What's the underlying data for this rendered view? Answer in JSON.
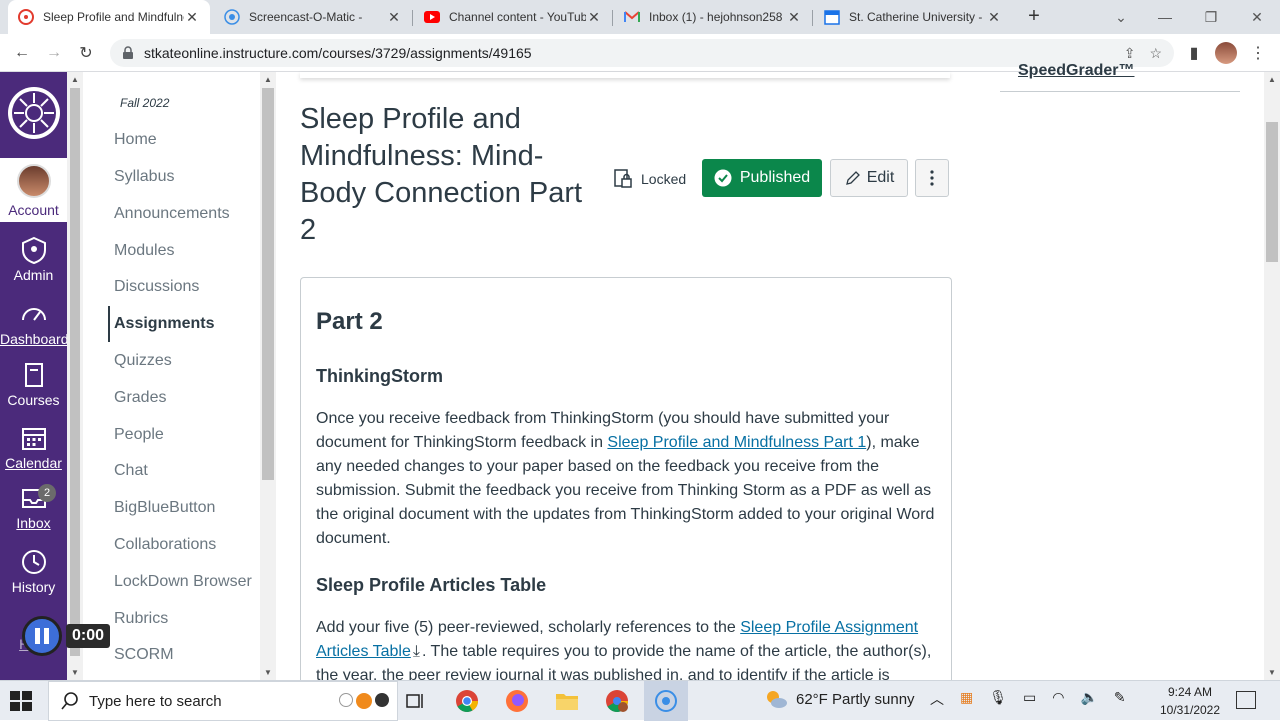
{
  "browser": {
    "tabs": [
      {
        "title": "Sleep Profile and Mindfulness",
        "active": true
      },
      {
        "title": "Screencast-O-Matic -"
      },
      {
        "title": "Channel content - YouTube"
      },
      {
        "title": "Inbox (1) - hejohnson258"
      },
      {
        "title": "St. Catherine University -"
      }
    ],
    "url": "stkateonline.instructure.com/courses/3729/assignments/49165"
  },
  "global_nav": {
    "account": "Account",
    "admin": "Admin",
    "dashboard": "Dashboard",
    "courses": "Courses",
    "calendar": "Calendar",
    "inbox": "Inbox",
    "inbox_badge": "2",
    "history": "History",
    "help": "Help"
  },
  "course_nav": {
    "term": "Fall 2022",
    "items": [
      "Home",
      "Syllabus",
      "Announcements",
      "Modules",
      "Discussions",
      "Assignments",
      "Quizzes",
      "Grades",
      "People",
      "Chat",
      "BigBlueButton",
      "Collaborations",
      "LockDown Browser",
      "Rubrics",
      "SCORM"
    ]
  },
  "assignment": {
    "title": "Sleep Profile and Mindfulness: Mind-Body Connection Part 2",
    "locked_label": "Locked",
    "published_label": "Published",
    "edit_label": "Edit",
    "speedgrader_label": "SpeedGrader™"
  },
  "description": {
    "heading": "Part 2",
    "sub1": "ThinkingStorm",
    "p1_before": "Once you receive feedback from ThinkingStorm (you should have submitted your document for ThinkingStorm feedback in ",
    "p1_link": "Sleep Profile and Mindfulness Part 1",
    "p1_after": "), make any needed changes to your paper based on the feedback you receive from the submission. Submit the feedback you receive from Thinking Storm as a PDF as well as the original document with the updates from ThinkingStorm added to your original Word document.",
    "sub2": "Sleep Profile Articles Table",
    "p2_before": "Add your five (5) peer-reviewed, scholarly references to the ",
    "p2_link": "Sleep Profile Assignment Articles Table",
    "p2_after": ". The table requires you to provide the name of the article, the author(s), the year, the peer review journal it was published in, and to identify if the article is"
  },
  "recorder": {
    "time": "0:00"
  },
  "taskbar": {
    "search_placeholder": "Type here to search",
    "weather": "62°F  Partly sunny",
    "time": "9:24 AM",
    "date": "10/31/2022"
  },
  "colors": {
    "canvas_purple": "#4b2a7b",
    "published_green": "#0b874b",
    "link_blue": "#0770a3"
  }
}
